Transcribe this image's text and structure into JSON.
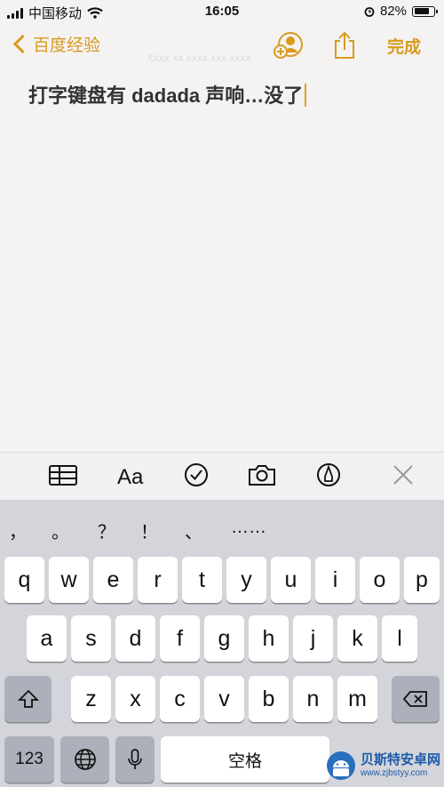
{
  "status_bar": {
    "carrier": "中国移动",
    "time": "16:05",
    "battery_percent": "82%",
    "battery_level": 0.82
  },
  "nav": {
    "back_label": "百度经验",
    "done_label": "完成"
  },
  "note": {
    "faint_line": "Xxxx xx xxxx xxx xxxx",
    "text": "打字键盘有 dadada 声响…没了"
  },
  "suggestions": [
    "，",
    "。",
    "？",
    "！",
    "、",
    "……"
  ],
  "keyboard": {
    "row1": [
      "q",
      "w",
      "e",
      "r",
      "t",
      "y",
      "u",
      "i",
      "o",
      "p"
    ],
    "row2": [
      "a",
      "s",
      "d",
      "f",
      "g",
      "h",
      "j",
      "k",
      "l"
    ],
    "row3": [
      "z",
      "x",
      "c",
      "v",
      "b",
      "n",
      "m"
    ],
    "num_label": "123",
    "space_label": "空格"
  },
  "watermark": {
    "title": "贝斯特安卓网",
    "url": "www.zjbstyy.com"
  },
  "colors": {
    "accent": "#d99a1e",
    "keyboard_bg": "#d3d5db"
  }
}
